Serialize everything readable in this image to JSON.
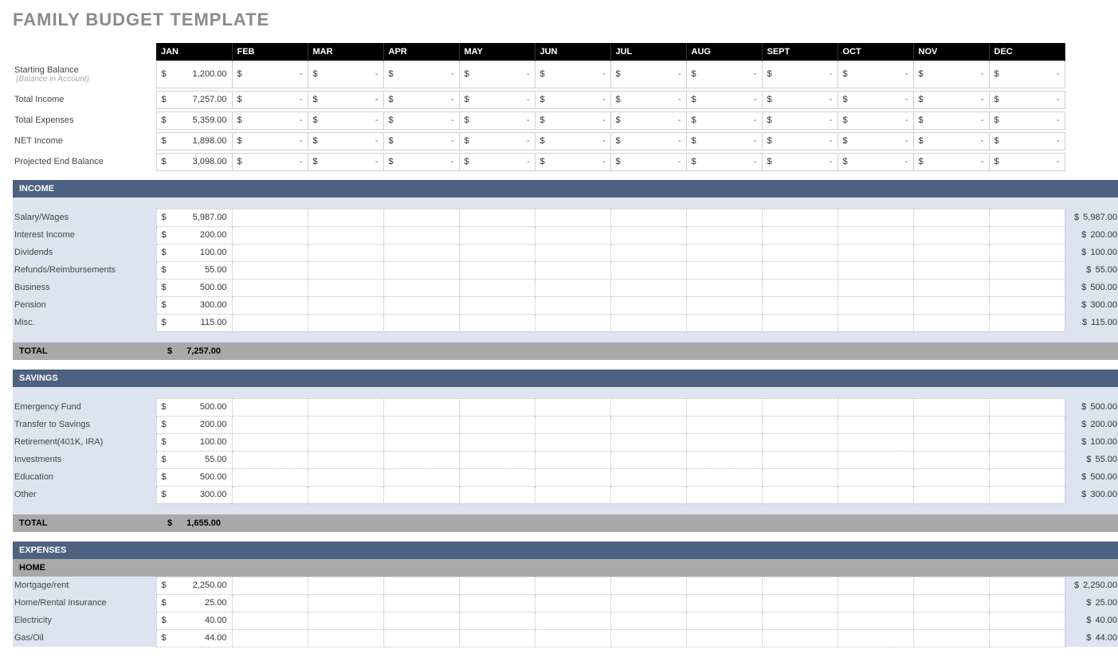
{
  "title": "FAMILY BUDGET TEMPLATE",
  "months": [
    "JAN",
    "FEB",
    "MAR",
    "APR",
    "MAY",
    "JUN",
    "JUL",
    "AUG",
    "SEPT",
    "OCT",
    "NOV",
    "DEC"
  ],
  "currency": "$",
  "summary": [
    {
      "label": "Starting Balance",
      "sub": "(Balance in Account)",
      "jan": "1,200.00"
    },
    {
      "label": "Total Income",
      "jan": "7,257.00"
    },
    {
      "label": "Total Expenses",
      "jan": "5,359.00"
    },
    {
      "label": "NET Income",
      "jan": "1,898.00"
    },
    {
      "label": "Projected End Balance",
      "jan": "3,098.00"
    }
  ],
  "sections": [
    {
      "name": "INCOME",
      "rows": [
        {
          "label": "Salary/Wages",
          "jan": "5,987.00",
          "total": "5,987.00"
        },
        {
          "label": "Interest Income",
          "jan": "200.00",
          "total": "200.00"
        },
        {
          "label": "Dividends",
          "jan": "100.00",
          "total": "100.00"
        },
        {
          "label": "Refunds/Reimbursements",
          "jan": "55.00",
          "total": "55.00"
        },
        {
          "label": "Business",
          "jan": "500.00",
          "total": "500.00"
        },
        {
          "label": "Pension",
          "jan": "300.00",
          "total": "300.00"
        },
        {
          "label": "Misc.",
          "jan": "115.00",
          "total": "115.00"
        }
      ],
      "total_label": "TOTAL",
      "total_jan": "7,257.00"
    },
    {
      "name": "SAVINGS",
      "rows": [
        {
          "label": "Emergency Fund",
          "jan": "500.00",
          "total": "500.00"
        },
        {
          "label": "Transfer to Savings",
          "jan": "200.00",
          "total": "200.00"
        },
        {
          "label": "Retirement(401K, IRA)",
          "jan": "100.00",
          "total": "100.00"
        },
        {
          "label": "Investments",
          "jan": "55.00",
          "total": "55.00"
        },
        {
          "label": "Education",
          "jan": "500.00",
          "total": "500.00"
        },
        {
          "label": "Other",
          "jan": "300.00",
          "total": "300.00"
        }
      ],
      "total_label": "TOTAL",
      "total_jan": "1,655.00"
    },
    {
      "name": "EXPENSES",
      "sub": "HOME",
      "rows": [
        {
          "label": "Mortgage/rent",
          "jan": "2,250.00",
          "total": "2,250.00"
        },
        {
          "label": "Home/Rental Insurance",
          "jan": "25.00",
          "total": "25.00"
        },
        {
          "label": "Electricity",
          "jan": "40.00",
          "total": "40.00"
        },
        {
          "label": "Gas/Oil",
          "jan": "44.00",
          "total": "44.00"
        }
      ]
    }
  ],
  "dash": "-"
}
